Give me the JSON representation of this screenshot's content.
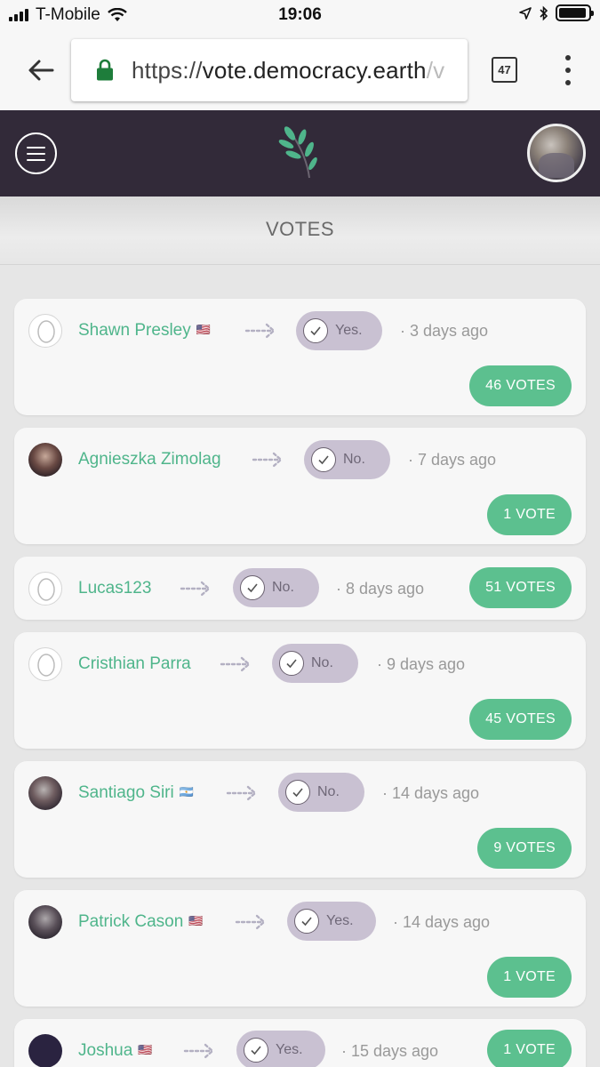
{
  "status_bar": {
    "carrier": "T-Mobile",
    "time": "19:06",
    "battery_level": 0.95
  },
  "browser": {
    "url_scheme": "https://",
    "url_domain": "vote.democracy.earth",
    "url_rest": "/v",
    "tab_count": "47"
  },
  "section": {
    "title": "VOTES"
  },
  "votes": [
    {
      "name": "Shawn Presley",
      "flag": "🇺🇸",
      "choice": "Yes.",
      "time": "· 3 days ago",
      "count": "46 VOTES"
    },
    {
      "name": "Agnieszka Zimolag",
      "flag": "",
      "choice": "No.",
      "time": "· 7 days ago",
      "count": "1 VOTE"
    },
    {
      "name": "Lucas123",
      "flag": "",
      "choice": "No.",
      "time": "· 8 days ago",
      "count": "51 VOTES"
    },
    {
      "name": "Cristhian Parra",
      "flag": "",
      "choice": "No.",
      "time": "· 9 days ago",
      "count": "45 VOTES"
    },
    {
      "name": "Santiago Siri",
      "flag": "🇦🇷",
      "choice": "No.",
      "time": "· 14 days ago",
      "count": "9 VOTES"
    },
    {
      "name": "Patrick Cason",
      "flag": "🇺🇸",
      "choice": "Yes.",
      "time": "· 14 days ago",
      "count": "1 VOTE"
    },
    {
      "name": "Joshua",
      "flag": "🇺🇸",
      "choice": "Yes.",
      "time": "· 15 days ago",
      "count": "1 VOTE"
    }
  ],
  "colors": {
    "header_bg": "#322a39",
    "name_green": "#4fb58b",
    "votes_button": "#5cc08f",
    "choice_pill": "#c9c1d2"
  }
}
